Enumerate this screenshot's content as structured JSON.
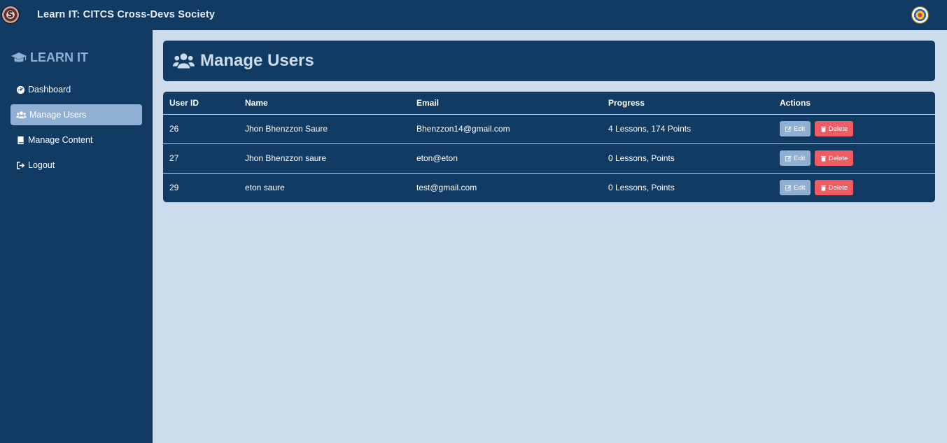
{
  "topbar": {
    "title": "Learn IT: CITCS Cross-Devs Society",
    "logo_left_text": "S"
  },
  "sidebar": {
    "brand": "LEARN IT",
    "items": [
      {
        "label": "Dashboard",
        "icon": "dashboard-icon"
      },
      {
        "label": "Manage Users",
        "icon": "users-icon",
        "active": true
      },
      {
        "label": "Manage Content",
        "icon": "book-icon"
      },
      {
        "label": "Logout",
        "icon": "logout-icon"
      }
    ]
  },
  "main": {
    "title": "Manage Users",
    "table": {
      "columns": [
        "User ID",
        "Name",
        "Email",
        "Progress",
        "Actions"
      ],
      "rows": [
        {
          "id": "26",
          "name": "Jhon Bhenzzon Saure",
          "email": "Bhenzzon14@gmail.com",
          "progress": "4 Lessons, 174 Points"
        },
        {
          "id": "27",
          "name": "Jhon Bhenzzon saure",
          "email": "eton@eton",
          "progress": "0 Lessons, Points"
        },
        {
          "id": "29",
          "name": "eton saure",
          "email": "test@gmail.com",
          "progress": "0 Lessons, Points"
        }
      ],
      "edit_label": "Edit",
      "delete_label": "Delete"
    }
  },
  "colors": {
    "navy": "#123b63",
    "background": "#ccdcec",
    "accent": "#8fb0d2",
    "danger": "#f15b63"
  }
}
